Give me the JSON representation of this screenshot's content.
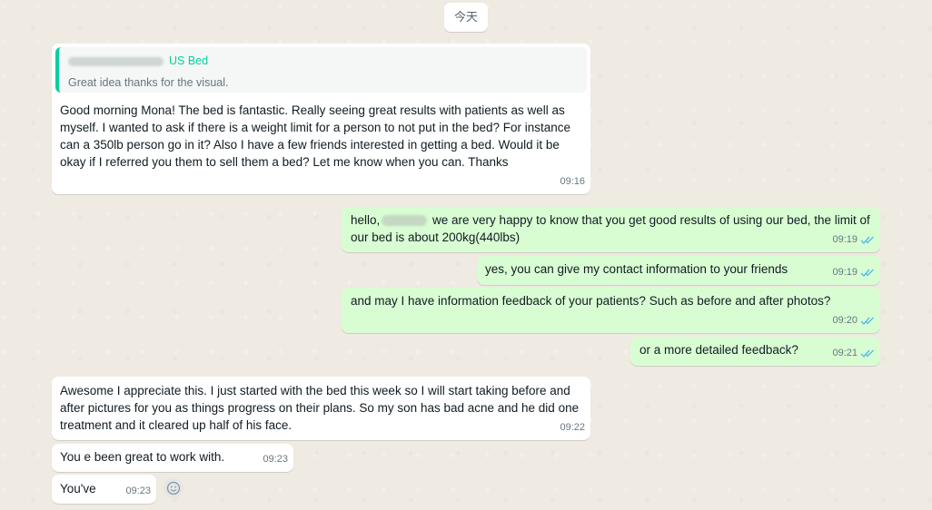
{
  "day_label": "今天",
  "messages": [
    {
      "quote": {
        "author": "US Bed",
        "text": "Great idea thanks for the visual."
      },
      "text": "Good morning Mona! The bed is fantastic. Really seeing great results with patients as well as myself. I wanted to ask if there is a weight limit for a person to not put in the bed? For instance can a 350lb person go in it? Also I have a few friends interested in getting a bed. Would it be okay if I referred you them to sell them a bed? Let me know when you can. Thanks",
      "time": "09:16"
    },
    {
      "text_before": "hello,",
      "text_after": " we are very happy to know that you get good results of using our bed, the limit of our bed is about 200kg(440lbs)",
      "time": "09:19"
    },
    {
      "text": "yes, you can give my contact information to your friends",
      "time": "09:19"
    },
    {
      "text": "and may I have information feedback of your patients? Such as before and after photos?",
      "time": "09:20"
    },
    {
      "text": "or a more detailed feedback?",
      "time": "09:21"
    },
    {
      "text": "Awesome I appreciate this. I just started with the bed this week so I will start taking before and after pictures for you as things progress on their plans. So my son has bad acne and he did one treatment and it cleared up half of his face.",
      "time": "09:22"
    },
    {
      "text": "You e been great to work with.",
      "time": "09:23"
    },
    {
      "text": "You've",
      "time": "09:23"
    }
  ],
  "colors": {
    "incoming": "#ffffff",
    "outgoing": "#d9fdd3",
    "quote_accent": "#06cf9c",
    "read_ticks": "#53bdeb"
  },
  "icons": {
    "read_receipt": "double-check-icon",
    "reaction": "emoji-smile-icon"
  }
}
